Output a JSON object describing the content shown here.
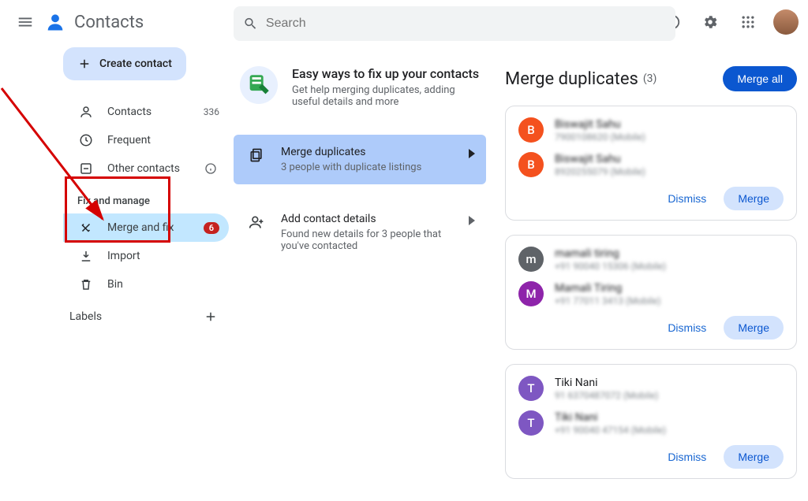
{
  "header": {
    "app_title": "Contacts",
    "search_placeholder": "Search"
  },
  "sidebar": {
    "create_label": "Create contact",
    "items": [
      {
        "label": "Contacts",
        "count": "336"
      },
      {
        "label": "Frequent"
      },
      {
        "label": "Other contacts"
      }
    ],
    "section_title": "Fix and manage",
    "manage": [
      {
        "label": "Merge and fix",
        "badge": "6"
      },
      {
        "label": "Import"
      },
      {
        "label": "Bin"
      }
    ],
    "labels_title": "Labels"
  },
  "fixpanel": {
    "headline": "Easy ways to fix up your contacts",
    "sub": "Get help merging duplicates, adding useful details and more",
    "actions": [
      {
        "title": "Merge duplicates",
        "sub": "3 people with duplicate listings"
      },
      {
        "title": "Add contact details",
        "sub": "Found new details for 3 people that you've contacted"
      }
    ]
  },
  "duplicates": {
    "title": "Merge duplicates",
    "count": "(3)",
    "merge_all": "Merge all",
    "dismiss": "Dismiss",
    "merge": "Merge",
    "cards": [
      {
        "initial": "B",
        "color": "#f4511e",
        "name1": "Biswajit Sahu",
        "phone1": "7900108620 (Mobile)",
        "name2": "Biswajit Sahu",
        "phone2": "8920255079 (Mobile)"
      },
      {
        "initial1": "m",
        "color1": "#5f6368",
        "initial2": "M",
        "color2": "#8e24aa",
        "name1": "mamali tiring",
        "phone1": "+91 90040 15306 (Mobile)",
        "name2": "Mamali Tiring",
        "phone2": "+91 77011 3413 (Mobile)"
      },
      {
        "initial": "T",
        "color": "#7e57c2",
        "name1": "Tiki Nani",
        "phone1": "91 6370487072 (Mobile)",
        "name2": "Tiki Nani",
        "phone2": "+91 90040 47154 (Mobile)",
        "clear_first": true
      }
    ]
  }
}
